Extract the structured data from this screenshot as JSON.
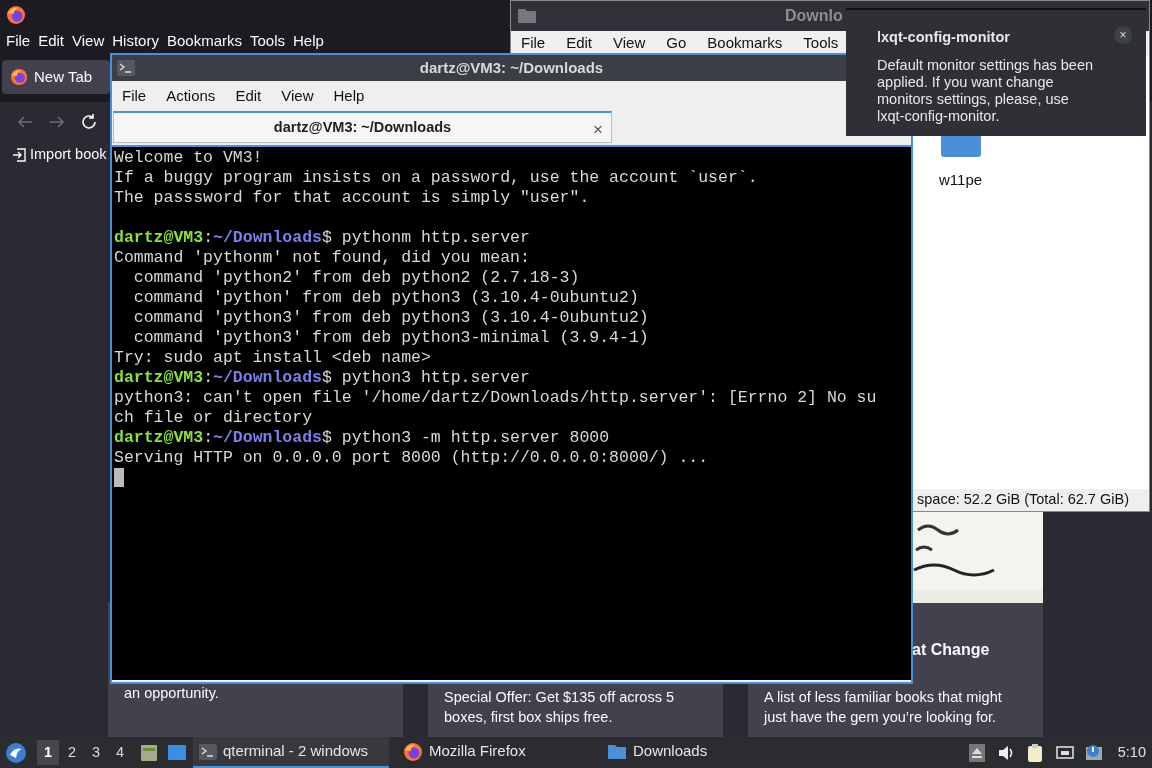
{
  "firefox": {
    "menu": [
      "File",
      "Edit",
      "View",
      "History",
      "Bookmarks",
      "Tools",
      "Help"
    ],
    "tabs": [
      {
        "label": "New Tab",
        "selected": true
      }
    ],
    "bookmark": "Import book",
    "cards": [
      {
        "text": "an opportunity."
      },
      {
        "text": "Special Offer: Get $135 off across 5 boxes, first box ships free."
      },
      {
        "kind": "picture",
        "title": "at Change",
        "text": "A list of less familiar books that might just have the gem you’re looking for."
      }
    ]
  },
  "file_manager": {
    "title": "Downlo",
    "menu": [
      "File",
      "Edit",
      "View",
      "Go",
      "Bookmarks",
      "Tools"
    ],
    "items": [
      {
        "label": "w11pe"
      }
    ],
    "status": "space: 52.2 GiB (Total: 62.7 GiB)"
  },
  "terminal": {
    "title": "dartz@VM3: ~/Downloads",
    "menu": [
      "File",
      "Actions",
      "Edit",
      "View",
      "Help"
    ],
    "tabs": [
      {
        "label": "dartz@VM3: ~/Downloads",
        "selected": true,
        "close": "×"
      }
    ],
    "lines": [
      {
        "kind": "output",
        "text": "Welcome to VM3!"
      },
      {
        "kind": "output",
        "text": "If a buggy program insists on a password, use the account `user`."
      },
      {
        "kind": "output",
        "text": "The passsword for that account is simply \"user\"."
      },
      {
        "kind": "blank"
      },
      {
        "kind": "prompt",
        "user": "dartz@VM3",
        "sep": ":",
        "path": "~/Downloads",
        "command": "$ pythonm http.server"
      },
      {
        "kind": "output",
        "text": "Command 'pythonm' not found, did you mean:"
      },
      {
        "kind": "output",
        "text": "  command 'python2' from deb python2 (2.7.18-3)"
      },
      {
        "kind": "output",
        "text": "  command 'python' from deb python3 (3.10.4-0ubuntu2)"
      },
      {
        "kind": "output",
        "text": "  command 'python3' from deb python3 (3.10.4-0ubuntu2)"
      },
      {
        "kind": "output",
        "text": "  command 'python3' from deb python3-minimal (3.9.4-1)"
      },
      {
        "kind": "output",
        "text": "Try: sudo apt install <deb name>"
      },
      {
        "kind": "prompt",
        "user": "dartz@VM3",
        "sep": ":",
        "path": "~/Downloads",
        "command": "$ python3 http.server"
      },
      {
        "kind": "output",
        "text": "python3: can't open file '/home/dartz/Downloads/http.server': [Errno 2] No su"
      },
      {
        "kind": "output",
        "text": "ch file or directory"
      },
      {
        "kind": "prompt",
        "user": "dartz@VM3",
        "sep": ":",
        "path": "~/Downloads",
        "command": "$ python3 -m http.server 8000"
      },
      {
        "kind": "output",
        "text": "Serving HTTP on 0.0.0.0 port 8000 (http://0.0.0.0:8000/) ..."
      },
      {
        "kind": "cursor"
      }
    ]
  },
  "notification": {
    "title": "lxqt-config-monitor",
    "body": "Default monitor settings has been applied. If you want change monitors settings, please, use lxqt-config-monitor.",
    "close": "×"
  },
  "taskbar": {
    "desktops": [
      {
        "label": "1",
        "selected": true
      },
      {
        "label": "2",
        "selected": false
      },
      {
        "label": "3",
        "selected": false
      },
      {
        "label": "4",
        "selected": false
      }
    ],
    "tasks": [
      {
        "kind": "terminal",
        "label": "qterminal - 2 windows",
        "selected": true
      },
      {
        "kind": "browser",
        "label": "Mozilla Firefox",
        "selected": false
      },
      {
        "kind": "folder",
        "label": "Downloads",
        "selected": false
      }
    ],
    "clock": "5:10"
  }
}
